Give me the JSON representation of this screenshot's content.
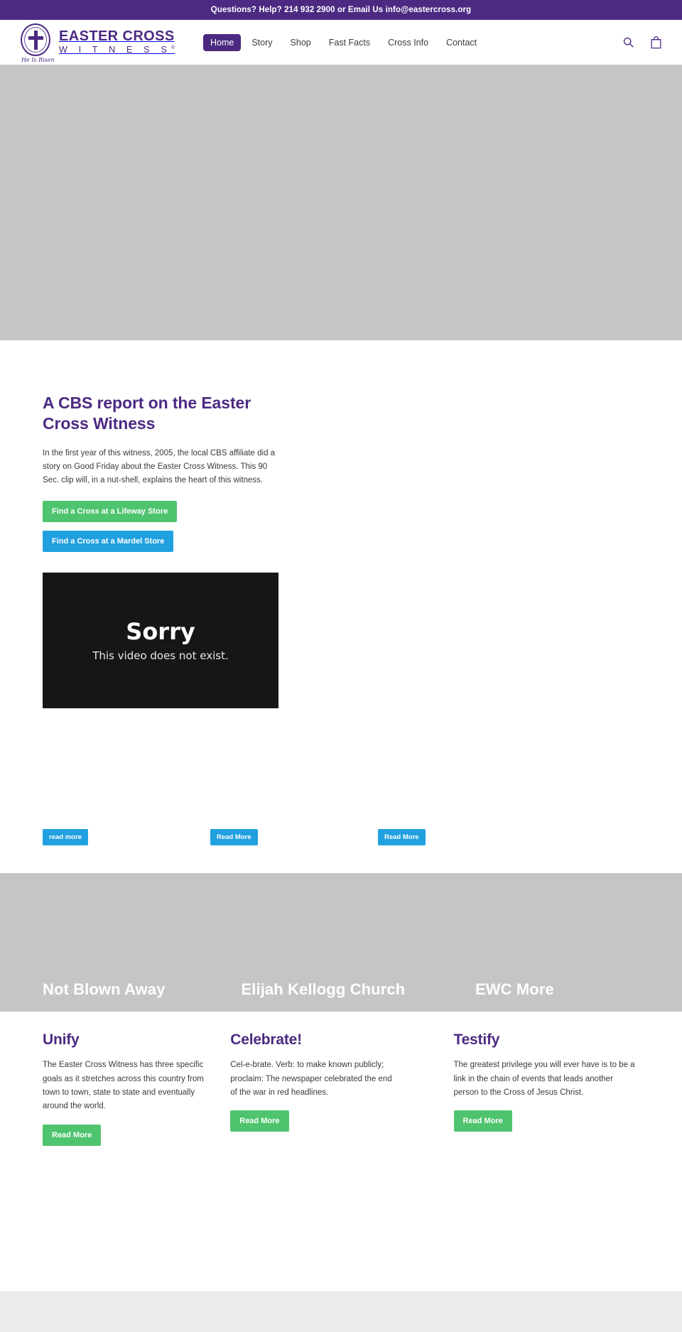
{
  "announcement": {
    "text": "Questions? Help? 214 932 2900 or Email Us info@eastercross.org"
  },
  "header": {
    "logo": {
      "line1": "EASTER CROSS",
      "line2": "W I T N E S S",
      "registered": "®",
      "seal_script": "He Is Risen"
    },
    "nav": [
      {
        "label": "Home",
        "active": true
      },
      {
        "label": "Story",
        "active": false
      },
      {
        "label": "Shop",
        "active": false
      },
      {
        "label": "Fast Facts",
        "active": false
      },
      {
        "label": "Cross Info",
        "active": false
      },
      {
        "label": "Contact",
        "active": false
      }
    ],
    "icons": {
      "search": "search-icon",
      "cart": "shopping-bag-icon"
    }
  },
  "cbs": {
    "title": "A CBS report on the Easter Cross Witness",
    "paragraph": "In the first year of this witness, 2005, the local CBS affiliate did a story on Good Friday about the Easter Cross Witness. This 90 Sec. clip will, in a nut-shell, explains the heart of this witness.",
    "button_lifeway": "Find a Cross at a Lifeway Store",
    "button_mardel": "Find a Cross at a Mardel Store",
    "video": {
      "headline": "Sorry",
      "subline": "This video does not exist."
    }
  },
  "readmore_row": [
    {
      "label": "read more"
    },
    {
      "label": "Read More"
    },
    {
      "label": "Read More"
    }
  ],
  "banner_titles": [
    {
      "title": "Not Blown Away"
    },
    {
      "title": "Elijah Kellogg Church"
    },
    {
      "title": "EWC More"
    }
  ],
  "features": [
    {
      "title": "Unify",
      "paragraph": "The Easter Cross Witness has three specific goals as it stretches across this country from town to town, state to state and eventually around the world.",
      "button": "Read More"
    },
    {
      "title": "Celebrate!",
      "paragraph": "Cel-e-brate. Verb: to make known publicly; proclaim: The newspaper celebrated the end of the war in red headlines.",
      "button": "Read More"
    },
    {
      "title": "Testify",
      "paragraph": "The greatest privilege you will ever have is to be a link in the chain of events that leads another person to the Cross of Jesus Christ.",
      "button": "Read More"
    }
  ],
  "colors": {
    "brand_purple": "#4c2a82",
    "green": "#4fc46e",
    "blue": "#21a0e0",
    "gray_placeholder": "#c5c5c5",
    "footer_gray": "#ebebeb"
  }
}
